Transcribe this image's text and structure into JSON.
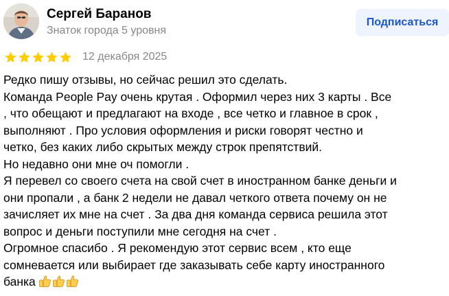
{
  "author": {
    "name": "Сергей Баранов",
    "level": "Знаток города 5 уровня",
    "avatar_icon": "user-photo"
  },
  "subscribe_button": {
    "label": "Подписаться"
  },
  "rating": {
    "stars": 5,
    "max_stars": 5,
    "star_color": "#ffcc00"
  },
  "date": "12 декабря 2025",
  "review_lines": [
    "Редко пишу отзывы, но сейчас решил это сделать.",
    "Команда People Pay очень крутая . Оформил через них 3 карты . Все",
    ", что обещают и предлагают на входе , все четко и главное в срок ,",
    "выполняют . Про условия оформления и риски говорят честно и",
    "четко, без каких либо скрытых между строк препятствий.",
    "Но недавно они мне оч помогли .",
    "Я перевел со своего счета на свой счет в иностранном банке деньги и",
    "они пропали , а банк 2 недели не давал четкого ответа почему он не",
    "зачисляет их мне на счет . За два дня команда сервиса решила этот",
    "вопрос и деньги поступили мне сегодня на счет .",
    "Огромное спасибо . Я рекомендую этот сервис всем , кто еще",
    "сомневается или выбирает где заказывать себе карту иностранного",
    "банка"
  ],
  "closing_emoji": {
    "icon": "thumbs-up-icon",
    "count": 3
  },
  "colors": {
    "accent": "#1957d0",
    "button_bg": "#eef3fe",
    "muted_text": "#878787",
    "star": "#ffcc00"
  }
}
